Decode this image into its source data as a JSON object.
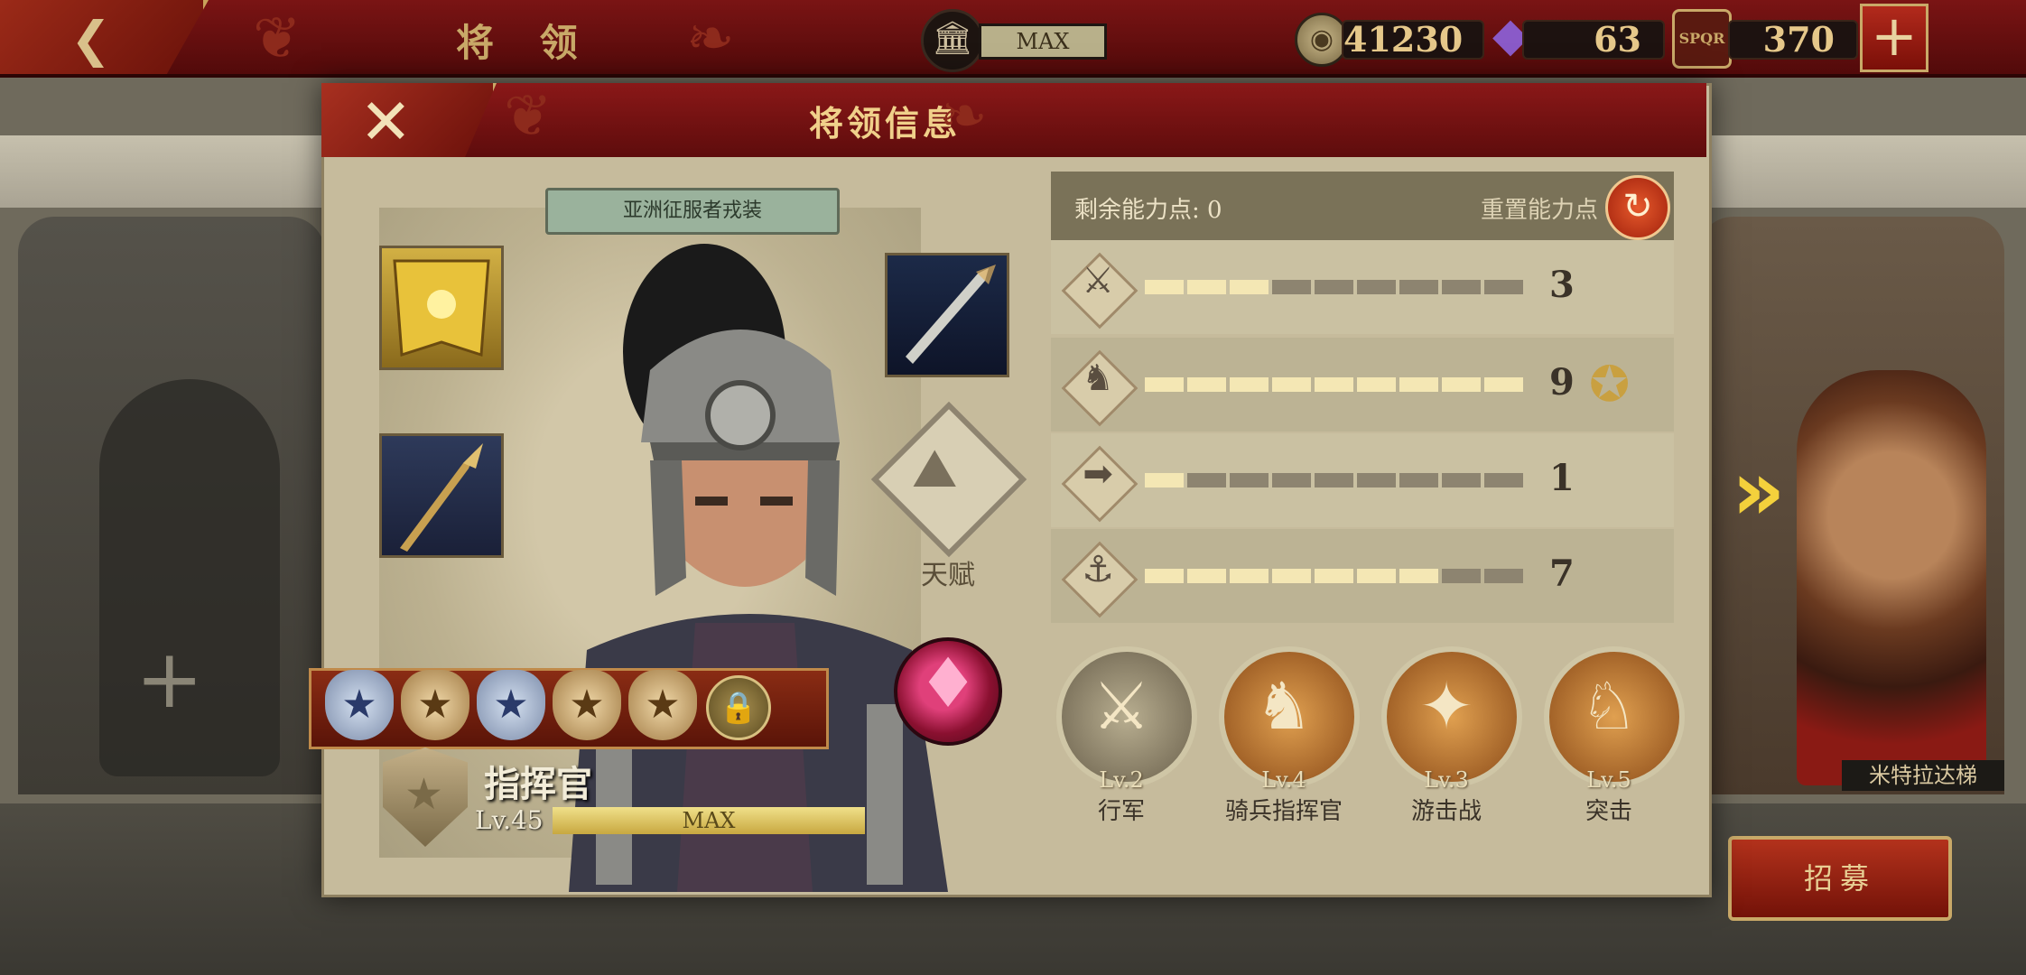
{
  "topbar": {
    "title": "将 领",
    "building_level": "MAX",
    "coins": "41230",
    "gems": "63",
    "spqr": "370",
    "spqr_icon_text": "SPQR"
  },
  "dialog": {
    "title": "将领信息",
    "costume": "亚洲征服者戎装",
    "talent_label": "天赋",
    "role_name": "指挥官",
    "level": "Lv.45",
    "level_bar": "MAX"
  },
  "stats": {
    "points_label": "剩余能力点: 0",
    "reset_label": "重置能力点",
    "rows": [
      {
        "icon": "sword-icon",
        "value": "3",
        "filled": 3,
        "total": 9
      },
      {
        "icon": "horse-icon",
        "value": "9",
        "filled": 9,
        "total": 9
      },
      {
        "icon": "bow-icon",
        "value": "1",
        "filled": 1,
        "total": 9
      },
      {
        "icon": "anchor-icon",
        "value": "7",
        "filled": 7,
        "total": 9
      }
    ]
  },
  "skills": [
    {
      "level": "Lv.2",
      "name": "行军"
    },
    {
      "level": "Lv.4",
      "name": "骑兵指挥官"
    },
    {
      "level": "Lv.3",
      "name": "游击战"
    },
    {
      "level": "Lv.5",
      "name": "突击"
    }
  ],
  "side": {
    "next_general_name": "米特拉达梯",
    "recruit": "招募"
  },
  "colors": {
    "accent_red": "#7a1414",
    "gold": "#c9a968",
    "panel": "#c6bb9c"
  }
}
